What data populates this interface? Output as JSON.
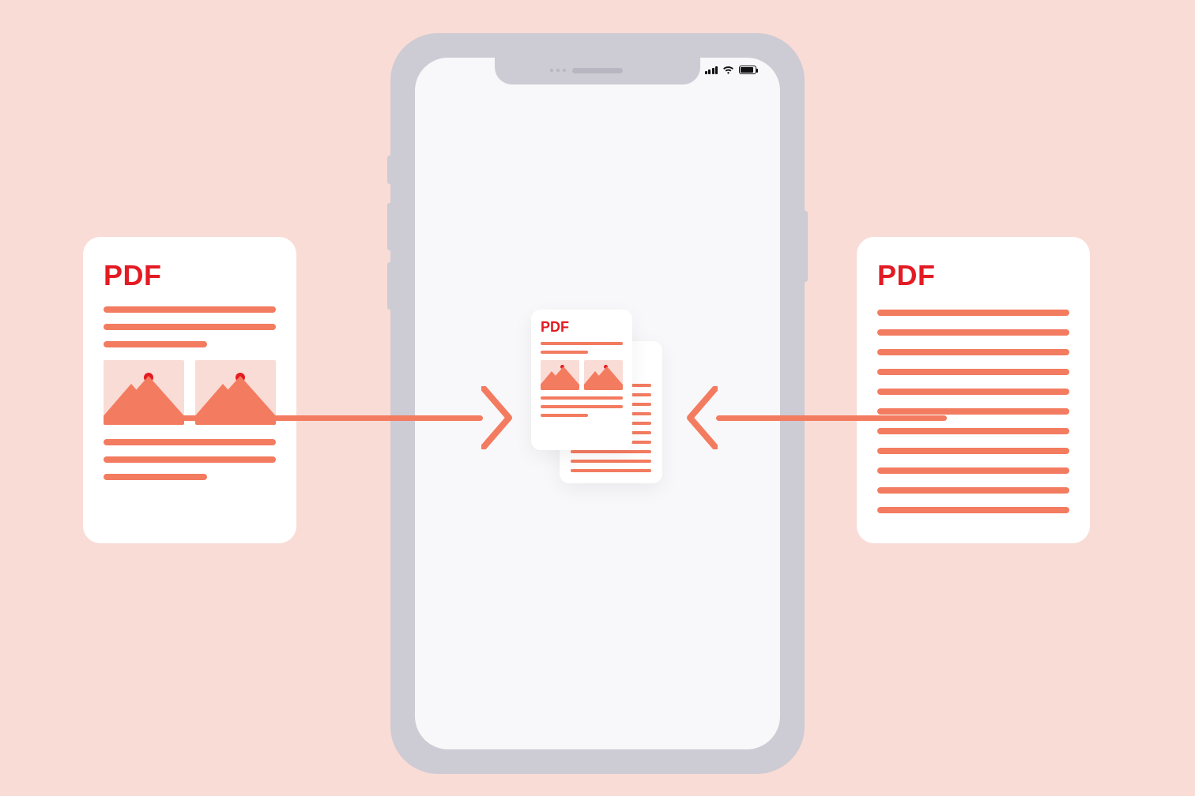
{
  "colors": {
    "background": "#f9dcd6",
    "accent": "#f37b60",
    "brand_red": "#e31b23",
    "phone_body": "#cdcbd4",
    "phone_screen": "#f8f7f9"
  },
  "left_doc": {
    "title": "PDF"
  },
  "right_doc": {
    "title": "PDF"
  },
  "center_doc": {
    "title": "PDF"
  },
  "concept": "merge-pdf-on-phone"
}
